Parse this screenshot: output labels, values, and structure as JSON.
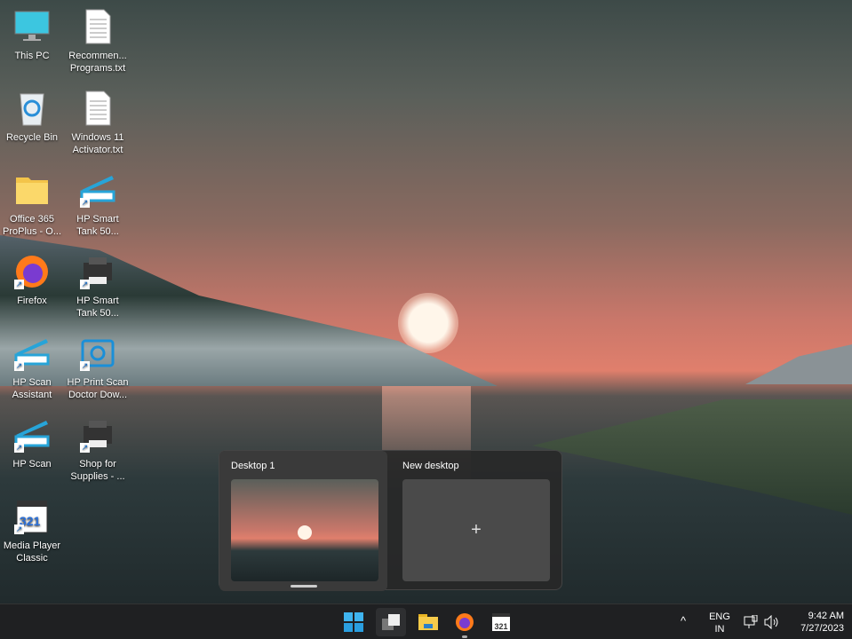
{
  "desktop_icons": [
    {
      "label": "This PC",
      "icon": "monitor-icon"
    },
    {
      "label": "Recommen... Programs.txt",
      "icon": "text-file-icon"
    },
    {
      "label": "Recycle Bin",
      "icon": "recycle-bin-icon"
    },
    {
      "label": "Windows 11 Activator.txt",
      "icon": "text-file-icon"
    },
    {
      "label": "Office 365 ProPlus - O...",
      "icon": "folder-icon"
    },
    {
      "label": "HP Smart Tank 50...",
      "icon": "scanner-icon"
    },
    {
      "label": "Firefox",
      "icon": "firefox-icon"
    },
    {
      "label": "HP Smart Tank 50...",
      "icon": "printer-icon"
    },
    {
      "label": "HP Scan Assistant",
      "icon": "scanner-icon"
    },
    {
      "label": "HP Print Scan Doctor Dow...",
      "icon": "hp-doctor-icon"
    },
    {
      "label": "HP Scan",
      "icon": "scanner-icon"
    },
    {
      "label": "Shop for Supplies - ...",
      "icon": "printer-icon"
    },
    {
      "label": "Media Player Classic",
      "icon": "media-player-icon"
    }
  ],
  "task_view": {
    "desktop1": "Desktop 1",
    "new_desktop": "New desktop",
    "plus": "+"
  },
  "taskbar": {
    "lang1": "ENG",
    "lang2": "IN",
    "time": "9:42 AM",
    "date": "7/27/2023",
    "chevron": "^",
    "mpc": "321"
  }
}
